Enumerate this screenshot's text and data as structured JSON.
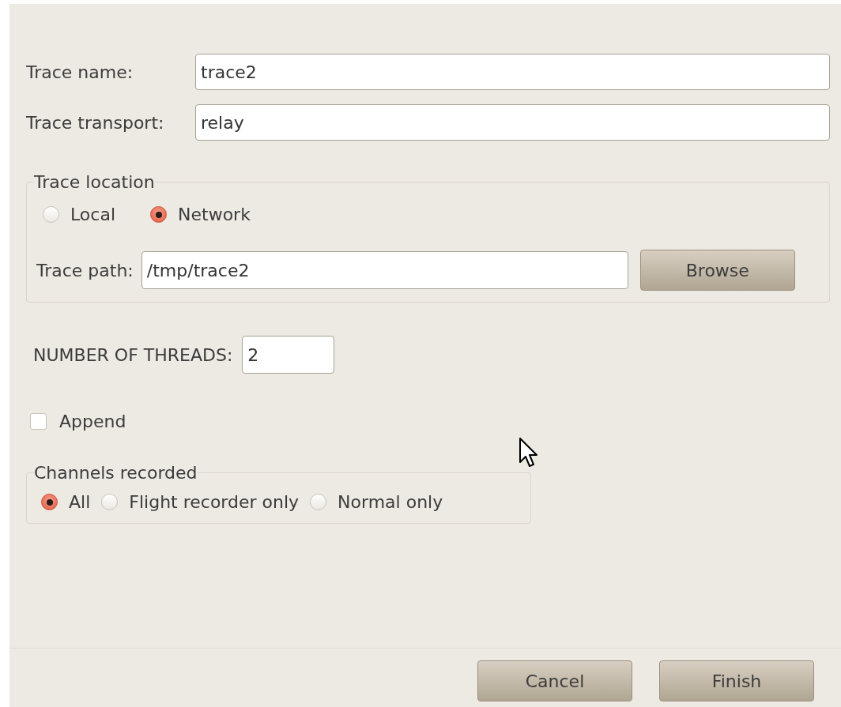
{
  "fields": [
    {
      "label": "Trace name:",
      "value": "trace2"
    },
    {
      "label": "Trace transport:",
      "value": "relay"
    }
  ],
  "trace_location": {
    "title": "Trace location",
    "options": [
      {
        "label": "Local",
        "selected": false
      },
      {
        "label": "Network",
        "selected": true
      }
    ],
    "path_label": "Trace path:",
    "path_value": "/tmp/trace2",
    "browse_button": "Browse"
  },
  "threads": {
    "label": "NUMBER OF THREADS:",
    "value": "2"
  },
  "append": {
    "label": "Append",
    "checked": false
  },
  "channels": {
    "title": "Channels recorded",
    "options": [
      {
        "label": "All",
        "selected": true
      },
      {
        "label": "Flight recorder only",
        "selected": false
      },
      {
        "label": "Normal only",
        "selected": false
      }
    ]
  },
  "buttons": [
    "Cancel",
    "Finish"
  ]
}
